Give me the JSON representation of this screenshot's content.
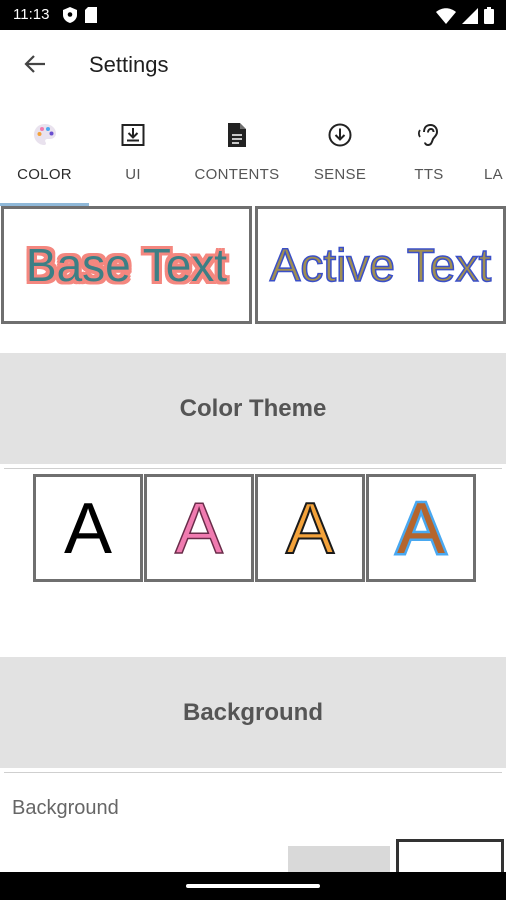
{
  "status": {
    "time": "11:13"
  },
  "appbar": {
    "title": "Settings"
  },
  "tabs": [
    {
      "label": "COLOR",
      "icon": "palette-icon",
      "active": true
    },
    {
      "label": "UI",
      "icon": "download-box-icon",
      "active": false
    },
    {
      "label": "CONTENTS",
      "icon": "document-icon",
      "active": false
    },
    {
      "label": "SENSE",
      "icon": "arrow-down-circle-icon",
      "active": false
    },
    {
      "label": "TTS",
      "icon": "ear-icon",
      "active": false
    },
    {
      "label": "LA",
      "icon": "",
      "active": false
    }
  ],
  "preview": {
    "base_text": "Base Text",
    "active_text": "Active Text"
  },
  "sections": {
    "color_theme": "Color Theme",
    "background": "Background"
  },
  "themes": [
    {
      "letter": "A",
      "fill": "#000000",
      "outline": "none"
    },
    {
      "letter": "A",
      "fill": "#f07bb0",
      "outline": "#6a2c4a"
    },
    {
      "letter": "A",
      "fill": "#f3a23a",
      "outline": "#1a1a1a"
    },
    {
      "letter": "A",
      "fill": "#b5652d",
      "outline": "#49a8f0"
    }
  ],
  "background": {
    "label": "Background"
  },
  "colors": {
    "section_bg": "#e2e2e2",
    "tab_indicator": "#8fb8d8",
    "base_text_fill": "#3d7f85",
    "base_text_outline": "#f4877f",
    "active_text_fill": "#a08f52",
    "active_text_outline": "#3a4fc8"
  }
}
